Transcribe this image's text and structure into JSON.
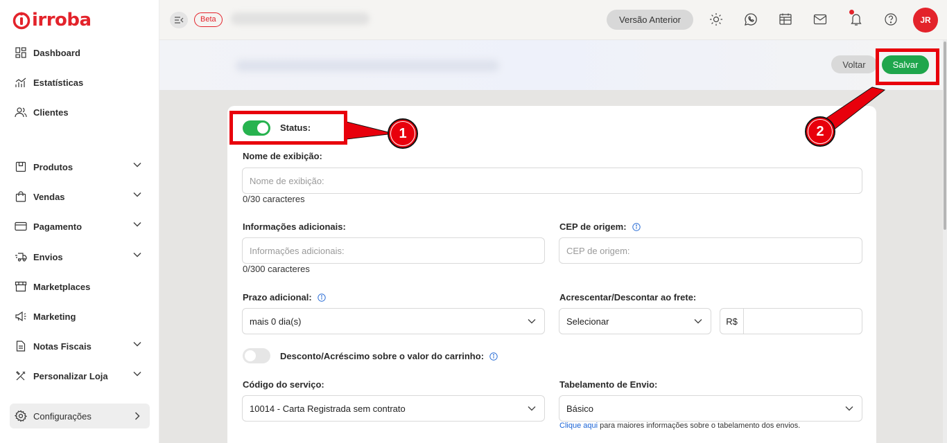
{
  "brand": {
    "name": "irroba",
    "color": "#e3232b"
  },
  "sidebar": {
    "items": [
      {
        "label": "Dashboard",
        "icon": "dashboard-icon",
        "expandable": false
      },
      {
        "label": "Estatísticas",
        "icon": "stats-icon",
        "expandable": false
      },
      {
        "label": "Clientes",
        "icon": "users-icon",
        "expandable": false
      },
      {
        "label": "Produtos",
        "icon": "box-icon",
        "expandable": true
      },
      {
        "label": "Vendas",
        "icon": "bag-icon",
        "expandable": true
      },
      {
        "label": "Pagamento",
        "icon": "card-icon",
        "expandable": true
      },
      {
        "label": "Envios",
        "icon": "truck-icon",
        "expandable": true
      },
      {
        "label": "Marketplaces",
        "icon": "store-icon",
        "expandable": false
      },
      {
        "label": "Marketing",
        "icon": "megaphone-icon",
        "expandable": false
      },
      {
        "label": "Notas Fiscais",
        "icon": "document-icon",
        "expandable": true
      },
      {
        "label": "Personalizar Loja",
        "icon": "tools-icon",
        "expandable": true
      },
      {
        "label": "Configurações",
        "icon": "gear-icon",
        "expandable": true,
        "active": true
      }
    ]
  },
  "topbar": {
    "beta_label": "Beta",
    "prev_version_label": "Versão Anterior",
    "avatar_initials": "JR",
    "icons": [
      "sun-icon",
      "whatsapp-icon",
      "calendar-icon",
      "mail-icon",
      "bell-icon",
      "help-icon"
    ]
  },
  "actions": {
    "back_label": "Voltar",
    "save_label": "Salvar",
    "save_color": "#1fa64c"
  },
  "form": {
    "status": {
      "label": "Status:",
      "on": true,
      "on_color": "#27b34f"
    },
    "display_name": {
      "label": "Nome de exibição:",
      "placeholder": "Nome de exibição:",
      "counter": "0/30 caracteres"
    },
    "additional_info": {
      "label": "Informações adicionais:",
      "placeholder": "Informações adicionais:",
      "counter": "0/300 caracteres"
    },
    "origin_cep": {
      "label": "CEP de origem:",
      "placeholder": "CEP de origem:"
    },
    "extra_deadline": {
      "label": "Prazo adicional:",
      "value": "mais 0 dia(s)"
    },
    "freight_adjust": {
      "label": "Acrescentar/Descontar ao frete:",
      "select_value": "Selecionar",
      "currency": "R$",
      "amount": ""
    },
    "cart_discount": {
      "label": "Desconto/Acréscimo sobre o valor do carrinho:",
      "on": false
    },
    "service_code": {
      "label": "Código do serviço:",
      "value": "10014 - Carta Registrada sem contrato"
    },
    "shipping_table": {
      "label": "Tabelamento de Envio:",
      "value": "Básico",
      "help_link": "Clique aqui",
      "help_text": " para maiores informações sobre o tabelamento dos envios."
    }
  },
  "annotations": {
    "step1": "1",
    "step2": "2",
    "color": "#e8000c"
  }
}
